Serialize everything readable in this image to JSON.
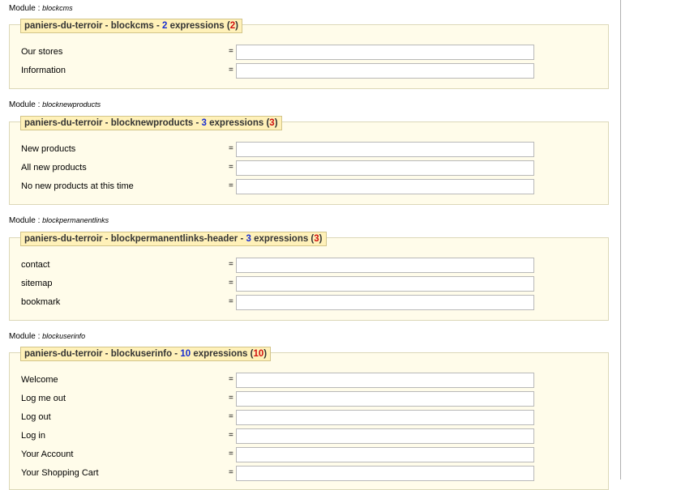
{
  "prefix": "Module : ",
  "modules": [
    {
      "name": "blockcms",
      "legend_prefix": "paniers-du-terroir - blockcms - ",
      "count": "2",
      "legend_mid": " expressions (",
      "total": "2",
      "legend_suffix": ")",
      "fields": [
        {
          "label": "Our stores",
          "eq": "=",
          "value": ""
        },
        {
          "label": "Information",
          "eq": "=",
          "value": ""
        }
      ]
    },
    {
      "name": "blocknewproducts",
      "legend_prefix": "paniers-du-terroir - blocknewproducts - ",
      "count": "3",
      "legend_mid": " expressions (",
      "total": "3",
      "legend_suffix": ")",
      "fields": [
        {
          "label": "New products",
          "eq": "=",
          "value": ""
        },
        {
          "label": "All new products",
          "eq": "=",
          "value": ""
        },
        {
          "label": "No new products at this time",
          "eq": "=",
          "value": ""
        }
      ]
    },
    {
      "name": "blockpermanentlinks",
      "legend_prefix": "paniers-du-terroir - blockpermanentlinks-header - ",
      "count": "3",
      "legend_mid": " expressions (",
      "total": "3",
      "legend_suffix": ")",
      "fields": [
        {
          "label": "contact",
          "eq": "=",
          "value": ""
        },
        {
          "label": "sitemap",
          "eq": "=",
          "value": ""
        },
        {
          "label": "bookmark",
          "eq": "=",
          "value": ""
        }
      ]
    },
    {
      "name": "blockuserinfo",
      "legend_prefix": "paniers-du-terroir - blockuserinfo - ",
      "count": "10",
      "legend_mid": " expressions (",
      "total": "10",
      "legend_suffix": ")",
      "fields": [
        {
          "label": "Welcome",
          "eq": "=",
          "value": ""
        },
        {
          "label": "Log me out",
          "eq": "=",
          "value": ""
        },
        {
          "label": "Log out",
          "eq": "=",
          "value": ""
        },
        {
          "label": "Log in",
          "eq": "=",
          "value": ""
        },
        {
          "label": "Your Account",
          "eq": "=",
          "value": ""
        },
        {
          "label": "Your Shopping Cart",
          "eq": "=",
          "value": ""
        }
      ]
    }
  ]
}
